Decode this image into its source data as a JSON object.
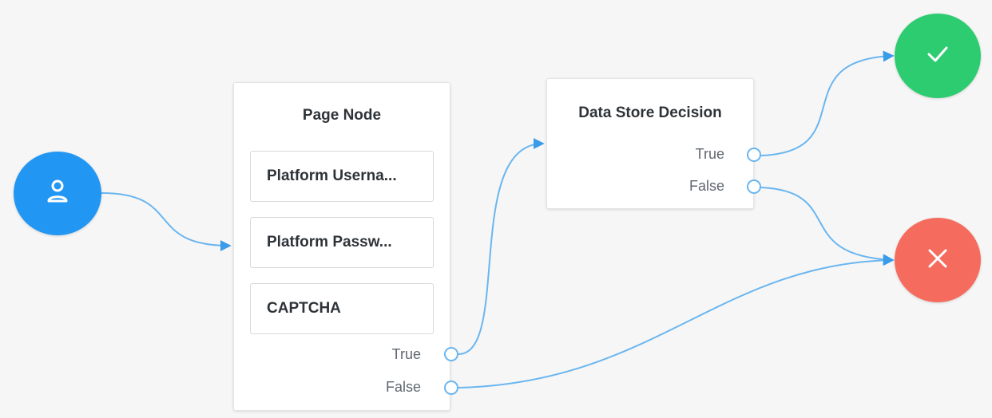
{
  "colors": {
    "wire": "#6ab6f0",
    "start": "#2196f3",
    "success": "#2ecc71",
    "failure": "#f56b5d"
  },
  "start_node": {
    "icon": "user-icon"
  },
  "page_node": {
    "title": "Page Node",
    "children": [
      "Platform Userna...",
      "Platform Passw...",
      "CAPTCHA"
    ],
    "outcomes": [
      "True",
      "False"
    ]
  },
  "decision_node": {
    "title": "Data Store Decision",
    "outcomes": [
      "True",
      "False"
    ]
  },
  "success_node": {
    "icon": "checkmark-icon"
  },
  "failure_node": {
    "icon": "close-icon"
  }
}
